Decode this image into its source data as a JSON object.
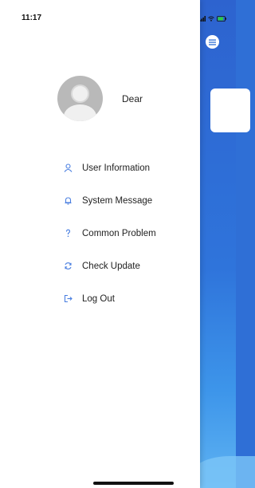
{
  "status_bar": {
    "time": "11:17"
  },
  "profile": {
    "name": "Dear"
  },
  "menu": {
    "items": [
      {
        "label": "User Information",
        "icon": "user-icon"
      },
      {
        "label": "System Message",
        "icon": "bell-icon"
      },
      {
        "label": "Common Problem",
        "icon": "question-icon"
      },
      {
        "label": "Check Update",
        "icon": "refresh-icon"
      },
      {
        "label": "Log Out",
        "icon": "logout-icon"
      }
    ]
  },
  "colors": {
    "icon_blue": "#4a7fe0",
    "background_blue": "#2f6fd6",
    "drawer_bg": "#ffffff"
  }
}
